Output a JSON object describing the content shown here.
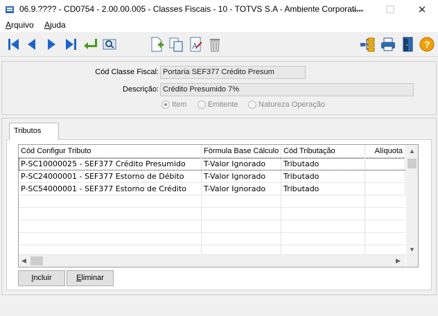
{
  "window": {
    "title": "06.9.???? - CD0754 - 2.00.00.005 - Classes Fiscais - 10 - TOTVS S.A - Ambiente Corporati...",
    "minimize": "—",
    "maximize": "☐",
    "close": "✕"
  },
  "menu": {
    "arquivo_first": "A",
    "arquivo_rest": "rquivo",
    "ajuda_first": "A",
    "ajuda_rest": "juda"
  },
  "toolbar": {
    "icons": [
      "first-record-icon",
      "previous-record-icon",
      "next-record-icon",
      "last-record-icon",
      "return-icon",
      "search-icon",
      "new-record-icon",
      "copy-record-icon",
      "edit-record-icon",
      "delete-record-icon",
      "hierarchy-icon",
      "print-icon",
      "exit-icon",
      "help-icon"
    ],
    "help_label": "?"
  },
  "header": {
    "cod_label": "Cód Classe Fiscal:",
    "cod_value": "Portaria SEF377 Crédito Presum",
    "desc_label": "Descrição:",
    "desc_value": "Crédito Presumido 7%",
    "radios": {
      "item": "Item",
      "emitente": "Emitente",
      "natureza": "Natureza Operação"
    }
  },
  "tab": {
    "label": "Tributos"
  },
  "grid": {
    "columns": [
      "Cód Configur Tributo",
      "Fórmula Base Cálculo",
      "Cód Tributação",
      "Alíquota"
    ],
    "rows": [
      [
        "P-SC10000025 - SEF377 Crédito Presumido",
        "T-Valor Ignorado",
        "Tributado",
        ""
      ],
      [
        "P-SC24000001 - SEF377 Estorno de Débito",
        "T-Valor Ignorado",
        "Tributado",
        ""
      ],
      [
        "P-SC54000001 - SEF377 Estorno de Crédito",
        "T-Valor Ignorado",
        "Tributado",
        ""
      ]
    ],
    "scroll_up": "▲",
    "scroll_down": "▼",
    "scroll_left": "◀",
    "scroll_right": "▶"
  },
  "buttons": {
    "incluir_first": "I",
    "incluir_rest": "ncluir",
    "eliminar_first": "E",
    "eliminar_rest": "liminar"
  },
  "colors": {
    "nav_blue": "#1e63c8",
    "return_green": "#4a9a1a",
    "help_orange": "#f0a000"
  }
}
